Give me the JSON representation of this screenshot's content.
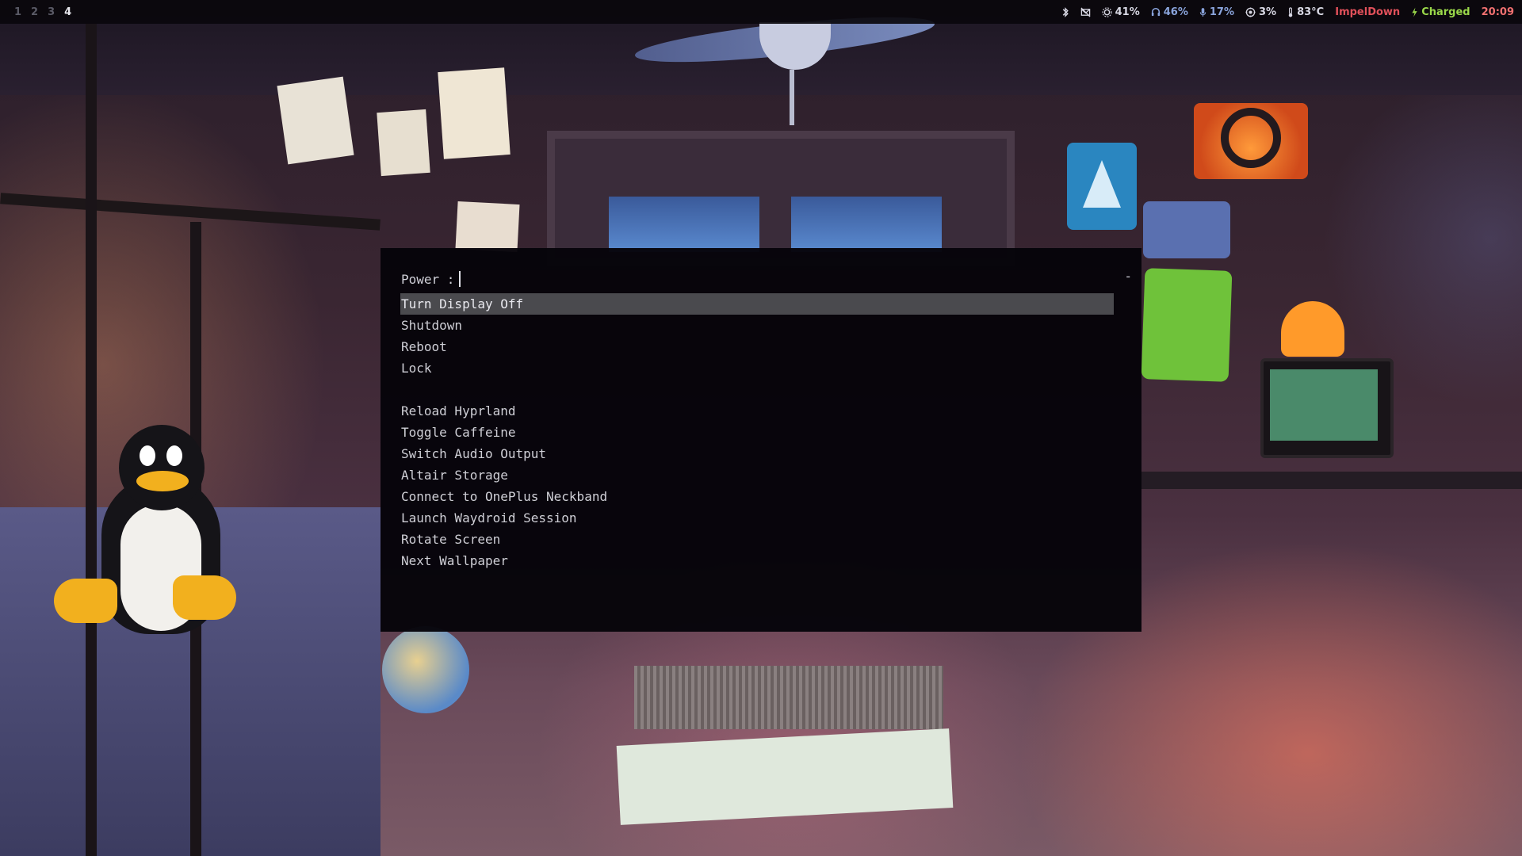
{
  "workspaces": [
    "1",
    "2",
    "3",
    "4"
  ],
  "active_workspace": "4",
  "status": {
    "bluetooth_icon": "bluetooth-icon",
    "notifications_icon": "notifications-off-icon",
    "brightness": "41%",
    "headphones": "46%",
    "microphone": "17%",
    "cpu": "3%",
    "temperature": "83°C",
    "network": "ImpelDown",
    "battery": "Charged",
    "clock": "20:09"
  },
  "colors": {
    "accent": "#8aa4dc",
    "network": "#e0505a",
    "battery": "#9ad84a",
    "clock": "#f07070"
  },
  "launcher": {
    "prompt": "Power :",
    "input_value": "",
    "mode_indicator": "-",
    "items": [
      "Turn Display Off",
      "Shutdown",
      "Reboot",
      "Lock",
      "",
      "Reload Hyprland",
      "Toggle Caffeine",
      "Switch Audio Output",
      "Altair Storage",
      "Connect to OnePlus Neckband",
      "Launch Waydroid Session",
      "Rotate Screen",
      "Next Wallpaper"
    ],
    "selected_index": 0
  }
}
